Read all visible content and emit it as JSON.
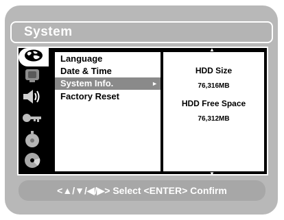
{
  "header": {
    "title": "System"
  },
  "sidebar": {
    "tabs": [
      {
        "icon": "globe-icon",
        "active": true
      },
      {
        "icon": "tv-icon"
      },
      {
        "icon": "speaker-icon"
      },
      {
        "icon": "key-icon"
      },
      {
        "icon": "timer-icon"
      },
      {
        "icon": "disc-icon"
      }
    ]
  },
  "menu": {
    "items": [
      {
        "label": "Language"
      },
      {
        "label": "Date & Time"
      },
      {
        "label": "System Info.",
        "selected": true
      },
      {
        "label": "Factory Reset"
      }
    ],
    "selected_arrow": "►"
  },
  "info": {
    "hdd_size_label": "HDD Size",
    "hdd_size_value": "76,316MB",
    "hdd_free_label": "HDD Free Space",
    "hdd_free_value": "76,312MB"
  },
  "scroll": {
    "up": "▲",
    "down": "▼"
  },
  "footer": {
    "hint": "<▲/▼/◀/▶> Select  <ENTER> Confirm"
  }
}
